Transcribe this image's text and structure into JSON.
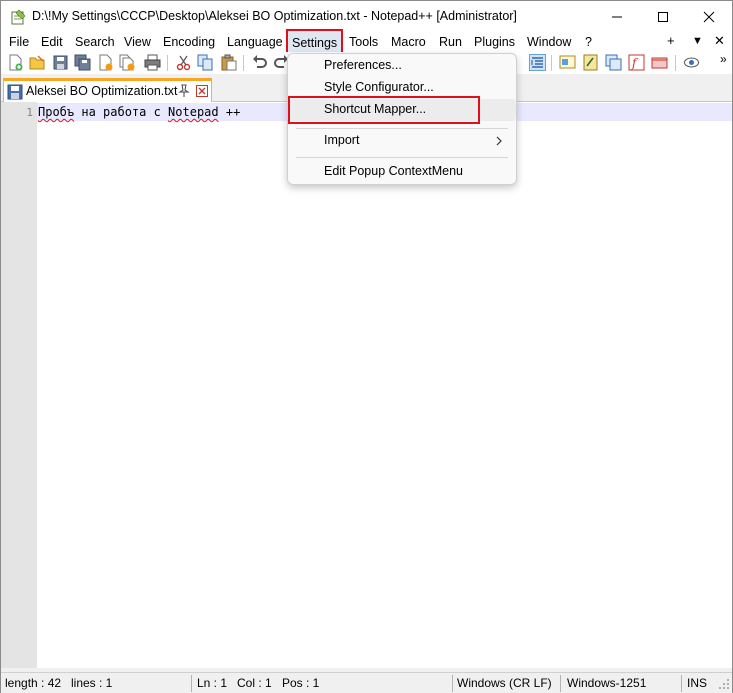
{
  "window": {
    "title": "D:\\!My Settings\\CCCP\\Desktop\\Aleksei BO Optimization.txt - Notepad++ [Administrator]",
    "controls": [
      "minimize-icon",
      "maximize-icon",
      "close-icon"
    ]
  },
  "menubar": {
    "items": [
      {
        "label": "File"
      },
      {
        "label": "Edit"
      },
      {
        "label": "Search"
      },
      {
        "label": "View"
      },
      {
        "label": "Encoding"
      },
      {
        "label": "Language"
      },
      {
        "label": "Settings"
      },
      {
        "label": "Tools"
      },
      {
        "label": "Macro"
      },
      {
        "label": "Run"
      },
      {
        "label": "Plugins"
      },
      {
        "label": "Window"
      },
      {
        "label": "?"
      }
    ],
    "right": {
      "add": "+",
      "dropdown": "▼",
      "close": "✕"
    }
  },
  "toolbar": {
    "icons": [
      "new-file-icon",
      "open-file-icon",
      "save-icon",
      "save-all-icon",
      "close-file-icon",
      "close-all-icon",
      "print-icon",
      "cut-icon",
      "copy-icon",
      "paste-icon",
      "undo-icon",
      "redo-icon",
      "word-wrap-icon",
      "document-map-icon",
      "function-list-icon",
      "folder-workspace-icon",
      "monitoring-icon",
      "record-macro-icon",
      "eye-icon"
    ],
    "overflow": "»"
  },
  "tabs": [
    {
      "label": "Aleksei BO Optimization.txt",
      "active": true
    }
  ],
  "editor": {
    "lines": [
      {
        "number": "1",
        "segments": [
          {
            "text": "Пробъ",
            "misspelled": true
          },
          {
            "text": " на работа с ",
            "misspelled": false
          },
          {
            "text": "Notepad",
            "misspelled": true
          },
          {
            "text": " ++",
            "misspelled": false
          }
        ]
      }
    ]
  },
  "dropdown": {
    "parent": "Settings",
    "items": [
      {
        "label": "Preferences..."
      },
      {
        "label": "Style Configurator..."
      },
      {
        "label": "Shortcut Mapper...",
        "highlighted": true
      },
      {
        "label": "Import",
        "submenu": true
      },
      {
        "label": "Edit Popup ContextMenu"
      }
    ]
  },
  "statusbar": {
    "length": "length : 42",
    "lines": "lines : 1",
    "ln": "Ln : 1",
    "col": "Col : 1",
    "pos": "Pos : 1",
    "eol": "Windows (CR LF)",
    "encoding": "Windows-1251",
    "mode": "INS"
  },
  "colors": {
    "highlight_box": "#e0101a",
    "tab_accent": "#f5a623",
    "current_line": "#e8e8ff",
    "gutter": "#e4e4e4"
  }
}
